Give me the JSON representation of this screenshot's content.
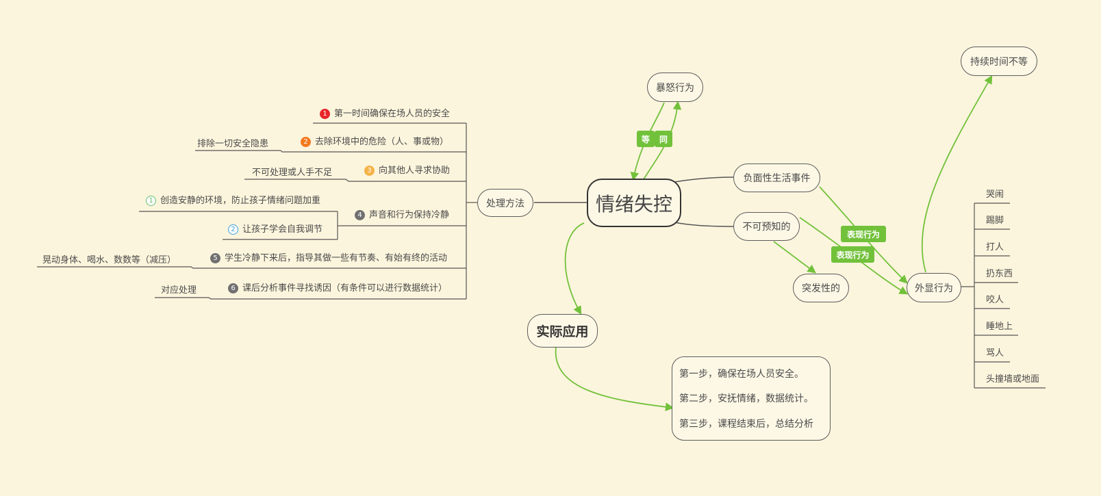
{
  "central": "情绪失控",
  "method": {
    "label": "处理方法",
    "items": [
      {
        "badge": "1",
        "text": "第一时间确保在场人员的安全"
      },
      {
        "badge": "2",
        "text": "去除环境中的危险（人、事或物）",
        "sub": "排除一切安全隐患"
      },
      {
        "badge": "3",
        "text": "向其他人寻求协助",
        "sub": "不可处理或人手不足"
      },
      {
        "badge": "4",
        "text": "声音和行为保持冷静",
        "subs": [
          {
            "badge": "1",
            "text": "创造安静的环境，防止孩子情绪问题加重"
          },
          {
            "badge": "2",
            "text": "让孩子学会自我调节"
          }
        ]
      },
      {
        "badge": "5",
        "text": "学生冷静下来后，指导其做一些有节奏、有始有终的活动",
        "sub": "晃动身体、喝水、数数等（减压）"
      },
      {
        "badge": "6",
        "text": "课后分析事件寻找诱因（有条件可以进行数据统计）",
        "sub": "对应处理"
      }
    ]
  },
  "rage": {
    "label": "暴怒行为",
    "tag_left": "等",
    "tag_right": "同"
  },
  "negative": {
    "label": "负面性生活事件"
  },
  "unpredictable": {
    "label": "不可预知的"
  },
  "sudden": {
    "label": "突发性的"
  },
  "tags": {
    "behavior1": "表现行为",
    "behavior2": "表现行为"
  },
  "duration": {
    "label": "持续时间不等"
  },
  "external": {
    "label": "外显行为",
    "items": [
      "哭闹",
      "踢脚",
      "打人",
      "扔东西",
      "咬人",
      "睡地上",
      "骂人",
      "头撞墙或地面"
    ]
  },
  "practice": {
    "label": "实际应用",
    "steps": [
      "第一步，确保在场人员安全。",
      "第二步，安抚情绪，数据统计。",
      "第三步，课程结束后，总结分析"
    ]
  },
  "colors": {
    "background": "#fcf5dd",
    "green": "#72c13b",
    "badge1": "#e8262a",
    "badge2": "#f27a1f",
    "badge3": "#f5b248",
    "badge_gray": "#707070",
    "sub_badge1": "#61c06d",
    "sub_badge2": "#3aa0d8"
  }
}
